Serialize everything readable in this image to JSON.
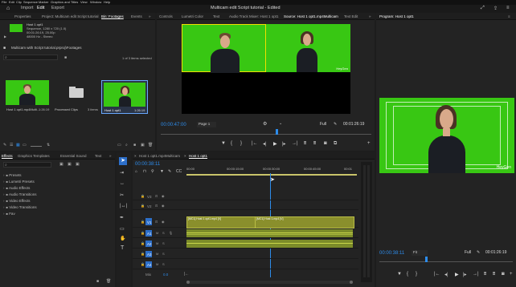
{
  "menu": {
    "items": [
      "File",
      "Edit",
      "Clip",
      "Sequence",
      "Marker",
      "Graphics and Titles",
      "View",
      "Window",
      "Help"
    ]
  },
  "header": {
    "workspaces": [
      "Import",
      "Edit",
      "Export"
    ],
    "active_workspace": "Edit",
    "title": "Multicam edit Script tutorial - Edited"
  },
  "project_panel": {
    "tabs": [
      "Properties",
      "Project: Multicam edit Script tutorial",
      "Bin: Footages",
      "Events"
    ],
    "active_tab": "Bin: Footages",
    "clip_info": {
      "name": "Host 1 opt1",
      "type": "Sequence, 1280 x 720 (1.0)",
      "duration": "00:01:26:19, 25.00p",
      "audio": "48000 Hz - Stereo"
    },
    "path": "Multicam with Script tutorial.prproj\\Footages",
    "selection_status": "1 of 3 items selected",
    "items": [
      {
        "name": "Host 1 opt1.mp4Multi...",
        "duration": "1:26:19"
      },
      {
        "name": "Processed Clips",
        "duration": "3 items"
      },
      {
        "name": "Host 1 opt1",
        "duration": "1:26:19"
      }
    ]
  },
  "source_panel": {
    "tabs": [
      "Controls",
      "Lumetri Color",
      "Text",
      "Audio Track Mixer: Host 1 opt1",
      "Source: Host 1 opt1.mp4Multicam",
      "Text Edit"
    ],
    "active_tab": "Source: Host 1 opt1.mp4Multicam",
    "timecode": "00:00:47:00",
    "page": "Page 1",
    "fit": "Full",
    "duration": "00:01:26:19",
    "watermark": "HeyGen"
  },
  "program_panel": {
    "tab": "Program: Host 1 opt1",
    "timecode": "00:00:38:11",
    "fit": "Fit",
    "quality": "Full",
    "duration": "00:01:26:19",
    "watermark": "HeyGen"
  },
  "effects_panel": {
    "tabs": [
      "Effects",
      "Graphics Templates",
      "Essential Sound",
      "Text"
    ],
    "active_tab": "Effects",
    "folders": [
      "Presets",
      "Lumetri Presets",
      "Audio Effects",
      "Audio Transitions",
      "Video Effects",
      "Video Transitions",
      "Fav"
    ]
  },
  "timeline": {
    "tabs": [
      "Host 1 opt1.mp4Multicam",
      "Host 1 opt1"
    ],
    "active_tab": "Host 1 opt1",
    "timecode": "00:00:38:11",
    "ruler": [
      "00:00",
      "00:00:15:00",
      "00:00:30:00",
      "00:00:45:00",
      "00:01"
    ],
    "tracks": {
      "video": [
        "V3",
        "V2",
        "V1"
      ],
      "audio": [
        "A1",
        "A2",
        "A3",
        "A4"
      ],
      "mix_label": "Mix",
      "mix_value": "0.0"
    },
    "clips": {
      "v1_a": "[MC1] Host 1 opt1.mp4 [V]",
      "v1_b": "[MC1] Host 1.mp4 [V]"
    }
  },
  "colors": {
    "accent": "#2d8ceb",
    "green_screen": "#38c713",
    "clip_video": "#8a8f2c",
    "clip_audio": "#7c8c29"
  }
}
